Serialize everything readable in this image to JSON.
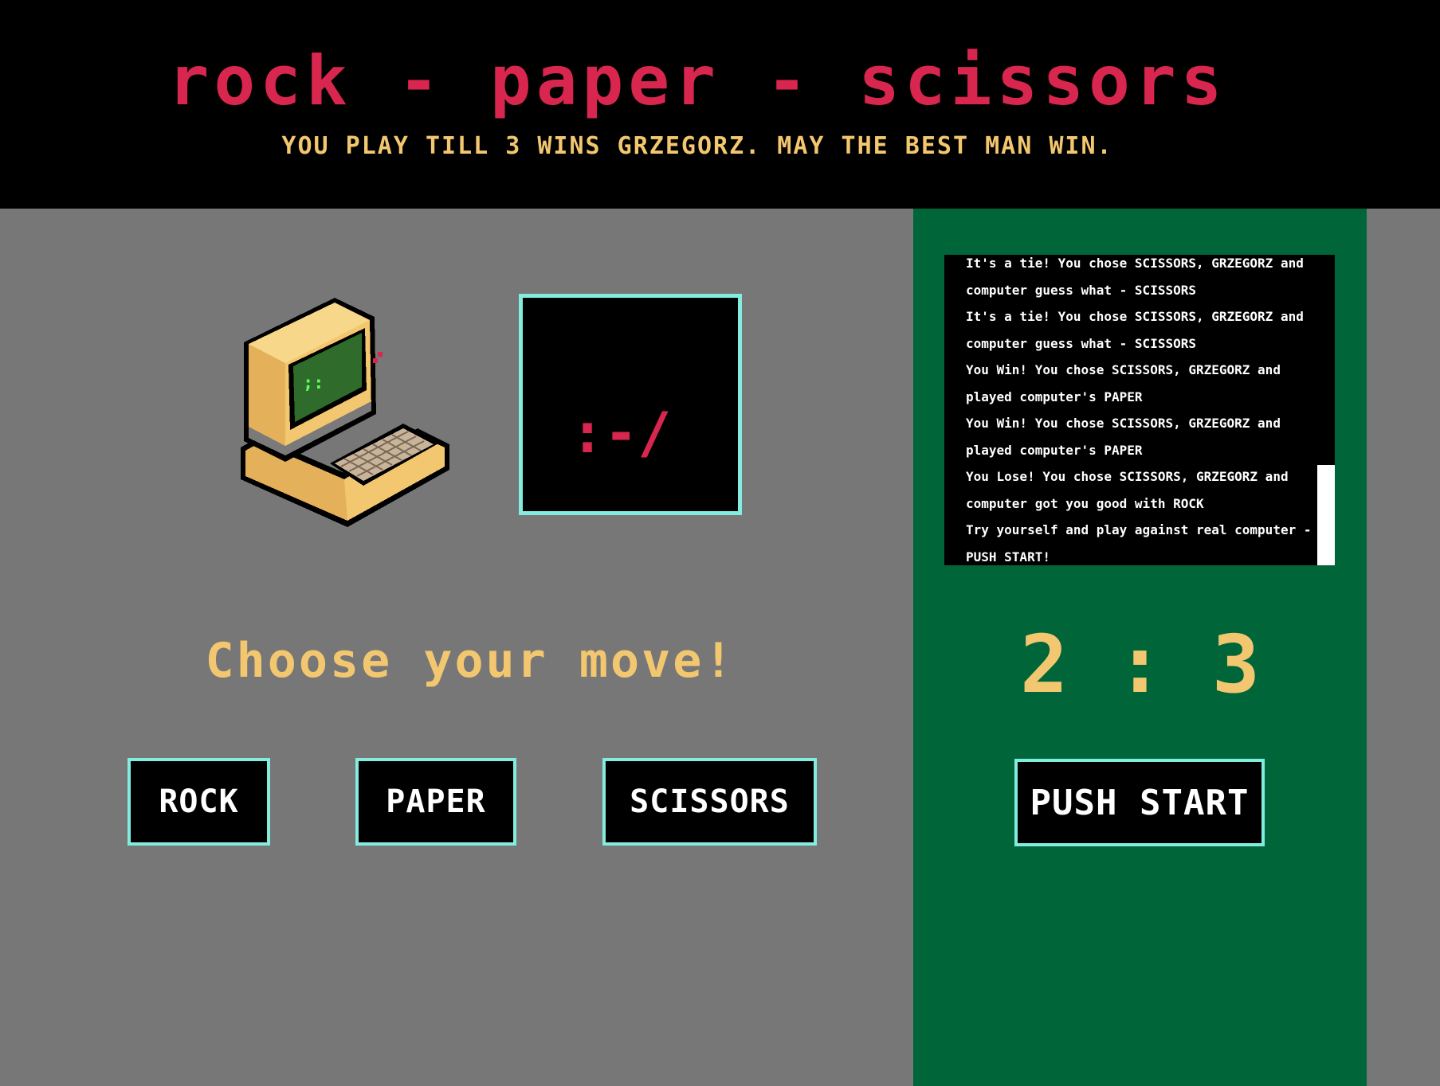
{
  "header": {
    "title": "rock - paper - scissors",
    "subtitle": "YOU PLAY TILL 3 WINS GRZEGORZ. MAY THE BEST MAN WIN."
  },
  "computer": {
    "icon": "computer-icon",
    "face": ":-/"
  },
  "prompt": "Choose your move!",
  "moves": {
    "rock_label": "ROCK",
    "paper_label": "PAPER",
    "scissors_label": "SCISSORS"
  },
  "log": {
    "lines": [
      "It's a tie! You chose SCISSORS, GRZEGORZ and",
      "computer guess what - SCISSORS",
      "It's a tie! You chose SCISSORS, GRZEGORZ and",
      "computer guess what - SCISSORS",
      "You Win! You chose SCISSORS, GRZEGORZ and",
      "played computer's PAPER",
      "You Win! You chose SCISSORS, GRZEGORZ and",
      "played computer's PAPER",
      "You Lose! You chose SCISSORS, GRZEGORZ and",
      "computer got you good with ROCK",
      "Try yourself and play against real computer -",
      "PUSH START!"
    ]
  },
  "score": {
    "player": "2",
    "separator": ":",
    "computer": "3"
  },
  "start_label": "PUSH START",
  "colors": {
    "background": "#777777",
    "header": "#000000",
    "title": "#d8264f",
    "accent": "#f3c76f",
    "panel": "#00663a",
    "button_border": "#82ecde"
  }
}
